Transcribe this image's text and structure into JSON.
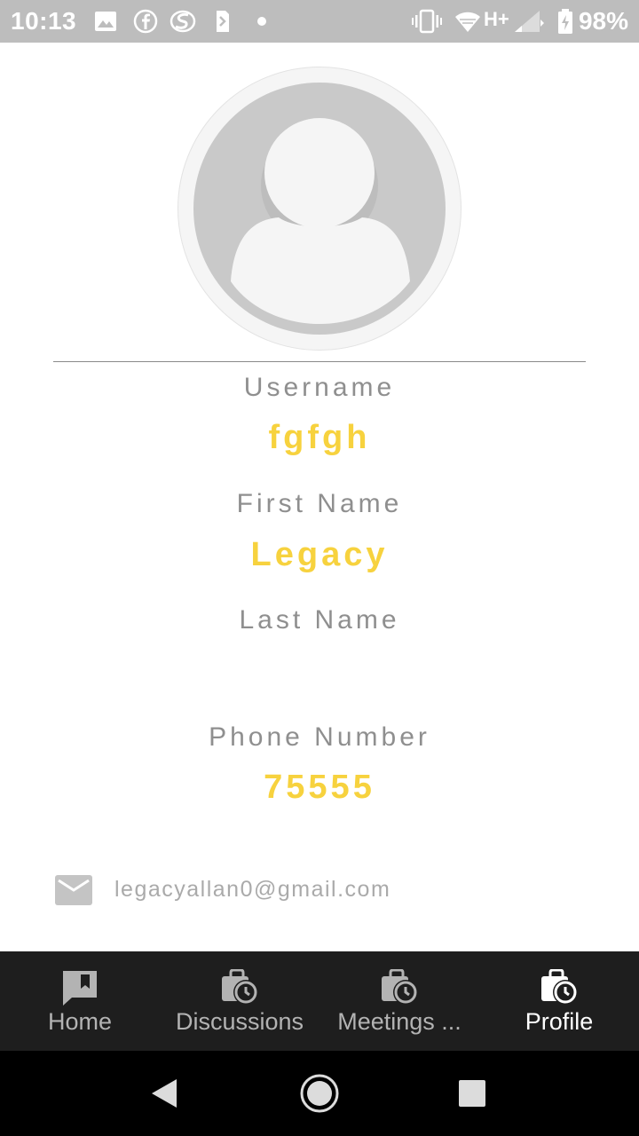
{
  "status_bar": {
    "time": "10:13",
    "battery": "98%",
    "network": "H+"
  },
  "profile": {
    "username_label": "Username",
    "username_value": "fgfgh",
    "first_name_label": "First Name",
    "first_name_value": "Legacy",
    "last_name_label": "Last Name",
    "last_name_value": "",
    "phone_label": "Phone Number",
    "phone_value": "75555",
    "email": "legacyallan0@gmail.com"
  },
  "bottom_nav": {
    "items": [
      {
        "label": "Home",
        "icon": "bookmark-chat-icon",
        "active": false
      },
      {
        "label": "Discussions",
        "icon": "briefcase-clock-icon",
        "active": false
      },
      {
        "label": "Meetings ...",
        "icon": "briefcase-clock-icon",
        "active": false
      },
      {
        "label": "Profile",
        "icon": "briefcase-clock-icon",
        "active": true
      }
    ]
  },
  "colors": {
    "accent": "#f7d23e",
    "label": "#8f8f8f",
    "status_bar": "#bdbdbd",
    "nav_bg": "#1e1e1e"
  }
}
